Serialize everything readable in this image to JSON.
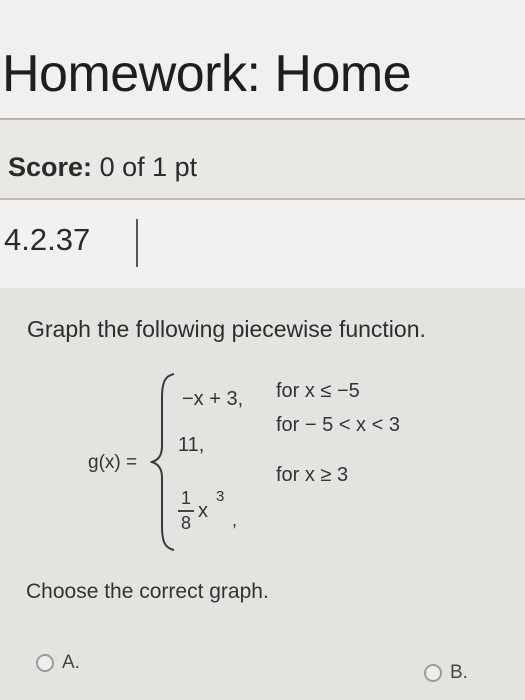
{
  "header": {
    "title": "Homework: Home"
  },
  "score": {
    "label": "Score:",
    "value": "0 of 1 pt"
  },
  "problem": {
    "id": "4.2.37"
  },
  "question": {
    "instruction": "Graph the following piecewise function.",
    "function_name": "g(x) =",
    "pieces": [
      {
        "expression": "−x + 3,",
        "condition": "for x ≤ −5"
      },
      {
        "expression": "11,",
        "condition": "for − 5 < x < 3"
      },
      {
        "numerator": "1",
        "denominator": "8",
        "variable": "x",
        "exponent": "3",
        "punctuation": ",",
        "condition": "for x ≥ 3"
      }
    ],
    "prompt": "Choose the correct graph."
  },
  "choices": [
    {
      "label": "A."
    },
    {
      "label": "B."
    }
  ]
}
